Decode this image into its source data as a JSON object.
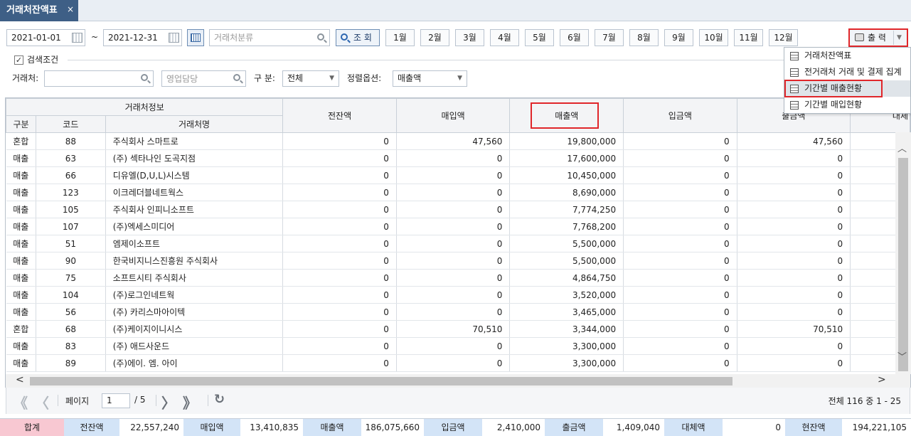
{
  "tab": {
    "title": "거래처잔액표",
    "close": "×"
  },
  "toolbar": {
    "date_from": "2021-01-01",
    "tilde": "~",
    "date_to": "2021-12-31",
    "category_placeholder": "거래처분류",
    "query_label": "조 회",
    "months": [
      "1월",
      "2월",
      "3월",
      "4월",
      "5월",
      "6월",
      "7월",
      "8월",
      "9월",
      "10월",
      "11월",
      "12월"
    ],
    "print_label": "출 력",
    "print_arrow": "▼"
  },
  "print_menu": {
    "items": [
      "거래처잔액표",
      "전거래처 거래 및 결제 집계",
      "기간별 매출현황",
      "기간별 매입현황"
    ],
    "highlighted_index": 2
  },
  "conditions": {
    "legend": "검색조건",
    "check": "✓",
    "client_label": "거래처:",
    "client_value": "",
    "sales_rep_placeholder": "영업담당",
    "type_label": "구 분:",
    "type_value": "전체",
    "sort_label": "정렬옵션:",
    "sort_value": "매출액",
    "arrow": "▼"
  },
  "grid": {
    "group_header": "거래처정보",
    "col_type": "구분",
    "col_code": "코드",
    "col_name": "거래처명",
    "col_prev": "전잔액",
    "col_purchase": "매입액",
    "col_sales": "매출액",
    "col_deposit": "입금액",
    "col_withdraw": "출금액",
    "col_partial": "대체",
    "rows": [
      {
        "type": "혼합",
        "code": "88",
        "name": "주식회사 스마트로",
        "prev": "0",
        "purchase": "47,560",
        "sales": "19,800,000",
        "deposit": "0",
        "withdraw": "47,560"
      },
      {
        "type": "매출",
        "code": "63",
        "name": "(주) 섹타나인 도곡지점",
        "prev": "0",
        "purchase": "0",
        "sales": "17,600,000",
        "deposit": "0",
        "withdraw": "0"
      },
      {
        "type": "매출",
        "code": "66",
        "name": "디유엘(D,U,L)시스템",
        "prev": "0",
        "purchase": "0",
        "sales": "10,450,000",
        "deposit": "0",
        "withdraw": "0"
      },
      {
        "type": "매출",
        "code": "123",
        "name": "이크레더블네트웍스",
        "prev": "0",
        "purchase": "0",
        "sales": "8,690,000",
        "deposit": "0",
        "withdraw": "0"
      },
      {
        "type": "매출",
        "code": "105",
        "name": "주식회사 인피니소프트",
        "prev": "0",
        "purchase": "0",
        "sales": "7,774,250",
        "deposit": "0",
        "withdraw": "0"
      },
      {
        "type": "매출",
        "code": "107",
        "name": "(주)엑세스미디어",
        "prev": "0",
        "purchase": "0",
        "sales": "7,768,200",
        "deposit": "0",
        "withdraw": "0"
      },
      {
        "type": "매출",
        "code": "51",
        "name": "엠제이소프트",
        "prev": "0",
        "purchase": "0",
        "sales": "5,500,000",
        "deposit": "0",
        "withdraw": "0"
      },
      {
        "type": "매출",
        "code": "90",
        "name": "한국비지니스진흥원 주식회사",
        "prev": "0",
        "purchase": "0",
        "sales": "5,500,000",
        "deposit": "0",
        "withdraw": "0"
      },
      {
        "type": "매출",
        "code": "75",
        "name": "소프트시티 주식회사",
        "prev": "0",
        "purchase": "0",
        "sales": "4,864,750",
        "deposit": "0",
        "withdraw": "0"
      },
      {
        "type": "매출",
        "code": "104",
        "name": "(주)로그인네트웍",
        "prev": "0",
        "purchase": "0",
        "sales": "3,520,000",
        "deposit": "0",
        "withdraw": "0"
      },
      {
        "type": "매출",
        "code": "56",
        "name": "(주) 카리스마아이텍",
        "prev": "0",
        "purchase": "0",
        "sales": "3,465,000",
        "deposit": "0",
        "withdraw": "0"
      },
      {
        "type": "혼합",
        "code": "68",
        "name": "(주)케이지이니시스",
        "prev": "0",
        "purchase": "70,510",
        "sales": "3,344,000",
        "deposit": "0",
        "withdraw": "70,510"
      },
      {
        "type": "매출",
        "code": "83",
        "name": "(주) 애드사운드",
        "prev": "0",
        "purchase": "0",
        "sales": "3,300,000",
        "deposit": "0",
        "withdraw": "0"
      },
      {
        "type": "매출",
        "code": "89",
        "name": "(주)에이. 엠. 아이",
        "prev": "0",
        "purchase": "0",
        "sales": "3,300,000",
        "deposit": "0",
        "withdraw": "0"
      }
    ]
  },
  "pager": {
    "first": "《",
    "prev": "〈",
    "page_label": "페이지",
    "page_value": "1",
    "page_total": "/ 5",
    "next": "〉",
    "last": "》",
    "refresh": "↻",
    "summary": "전체 116 중 1 - 25"
  },
  "totals": {
    "sum_label": "합계",
    "prev_label": "전잔액",
    "prev_value": "22,557,240",
    "purchase_label": "매입액",
    "purchase_value": "13,410,835",
    "sales_label": "매출액",
    "sales_value": "186,075,660",
    "deposit_label": "입금액",
    "deposit_value": "2,410,000",
    "withdraw_label": "출금액",
    "withdraw_value": "1,409,040",
    "transfer_label": "대체액",
    "transfer_value": "0",
    "current_label": "현잔액",
    "current_value": "194,221,105"
  },
  "colors": {
    "accent_red": "#e0262a",
    "tab_bg": "#3e5f86",
    "label_blue": "#d3e4f7",
    "sum_pink": "#f8c8d2"
  }
}
